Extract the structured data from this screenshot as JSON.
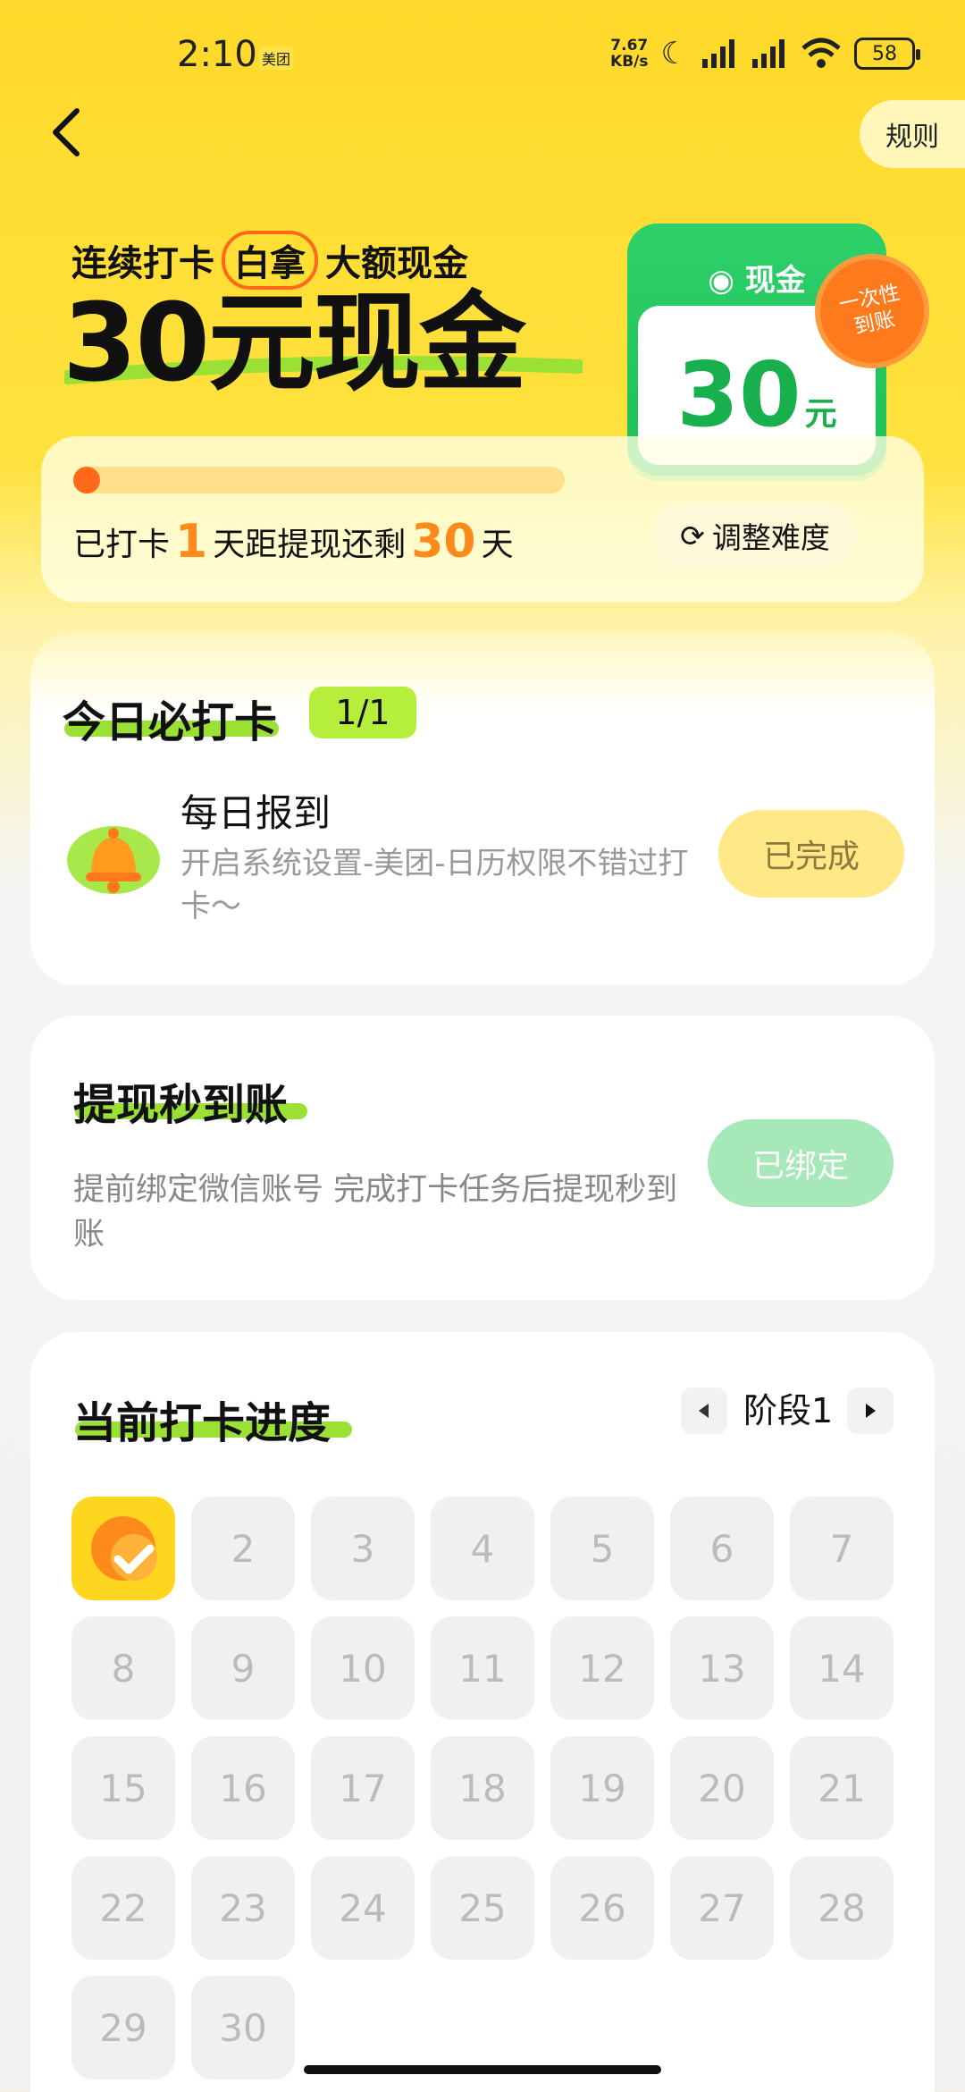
{
  "status_bar": {
    "time": "2:10",
    "app_tag": "美团",
    "net_speed_value": "7.67",
    "net_speed_unit": "KB/s",
    "battery": "58",
    "icons": [
      "moon-icon",
      "signal-icon",
      "signal-icon",
      "wifi-icon",
      "battery-icon"
    ]
  },
  "header": {
    "rules_label": "规则"
  },
  "hero": {
    "subtitle_prefix": "连续打卡",
    "subtitle_highlight": "白拿",
    "subtitle_suffix": "大额现金",
    "title": "30元现金",
    "cash_card_label": "现金",
    "cash_amount": "30",
    "cash_unit": "元",
    "stamp_line1": "一次性",
    "stamp_line2": "到账"
  },
  "progress": {
    "value_fraction": 0.0333,
    "text_prefix": "已打卡",
    "days_done": "1",
    "text_middle": "天距提现还剩",
    "days_left": "30",
    "text_suffix": "天",
    "adjust_label": "调整难度",
    "colors": {
      "fill": "#ff6a1a",
      "track": "#ffe08a"
    }
  },
  "daily_task": {
    "title": "今日必打卡",
    "count": "1/1",
    "task_name": "每日报到",
    "task_desc": "开启系统设置-美团-日历权限不错过打卡～",
    "button_label": "已完成"
  },
  "withdraw": {
    "title": "提现秒到账",
    "desc": "提前绑定微信账号 完成打卡任务后提现秒到账",
    "button_label": "已绑定"
  },
  "checkin_progress": {
    "title": "当前打卡进度",
    "stage_label": "阶段1",
    "days": [
      {
        "label": "",
        "done": true
      },
      {
        "label": "2"
      },
      {
        "label": "3"
      },
      {
        "label": "4"
      },
      {
        "label": "5"
      },
      {
        "label": "6"
      },
      {
        "label": "7"
      },
      {
        "label": "8"
      },
      {
        "label": "9"
      },
      {
        "label": "10"
      },
      {
        "label": "11"
      },
      {
        "label": "12"
      },
      {
        "label": "13"
      },
      {
        "label": "14"
      },
      {
        "label": "15"
      },
      {
        "label": "16"
      },
      {
        "label": "17"
      },
      {
        "label": "18"
      },
      {
        "label": "19"
      },
      {
        "label": "20"
      },
      {
        "label": "21"
      },
      {
        "label": "22"
      },
      {
        "label": "23"
      },
      {
        "label": "24"
      },
      {
        "label": "25"
      },
      {
        "label": "26"
      },
      {
        "label": "27"
      },
      {
        "label": "28"
      },
      {
        "label": "29"
      },
      {
        "label": "30"
      }
    ]
  },
  "colors": {
    "brand_yellow": "#ffd92a",
    "accent_green": "#1fbf55",
    "accent_orange": "#ff6a1a",
    "lime": "#b6ee3c"
  }
}
